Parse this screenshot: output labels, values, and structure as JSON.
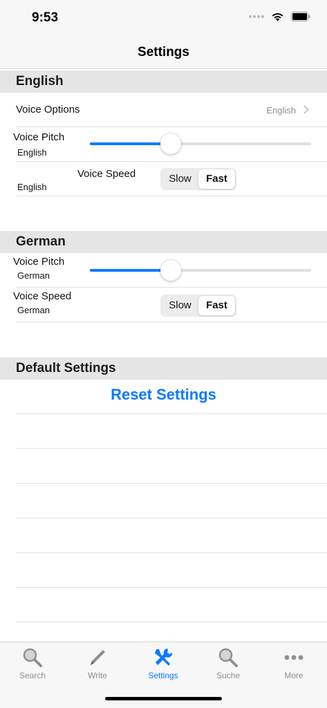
{
  "status_bar": {
    "time": "9:53"
  },
  "nav": {
    "title": "Settings"
  },
  "sections": {
    "english": {
      "header": "English",
      "voice_options": {
        "label": "Voice Options",
        "value": "English"
      },
      "pitch": {
        "label": "Voice Pitch",
        "sublabel": "English",
        "value_percent": 35
      },
      "speed": {
        "label": "Voice Speed",
        "sublabel": "English",
        "options": [
          "Slow",
          "Fast"
        ],
        "selected": "Fast"
      }
    },
    "german": {
      "header": "German",
      "pitch": {
        "label": "Voice Pitch",
        "sublabel": "German",
        "value_percent": 35
      },
      "speed": {
        "label": "Voice Speed",
        "sublabel": "German",
        "options": [
          "Slow",
          "Fast"
        ],
        "selected": "Fast"
      }
    },
    "defaults": {
      "header": "Default Settings",
      "reset_label": "Reset Settings"
    }
  },
  "tab_bar": {
    "tabs": [
      {
        "label": "Search",
        "icon": "search-icon",
        "active": false
      },
      {
        "label": "Write",
        "icon": "pencil-icon",
        "active": false
      },
      {
        "label": "Settings",
        "icon": "tools-icon",
        "active": true
      },
      {
        "label": "Suche",
        "icon": "search-icon",
        "active": false
      },
      {
        "label": "More",
        "icon": "more-icon",
        "active": false
      }
    ]
  },
  "colors": {
    "accent": "#0a7aff",
    "section_bg": "#e5e5e5",
    "bar_bg": "#f7f7f7"
  }
}
